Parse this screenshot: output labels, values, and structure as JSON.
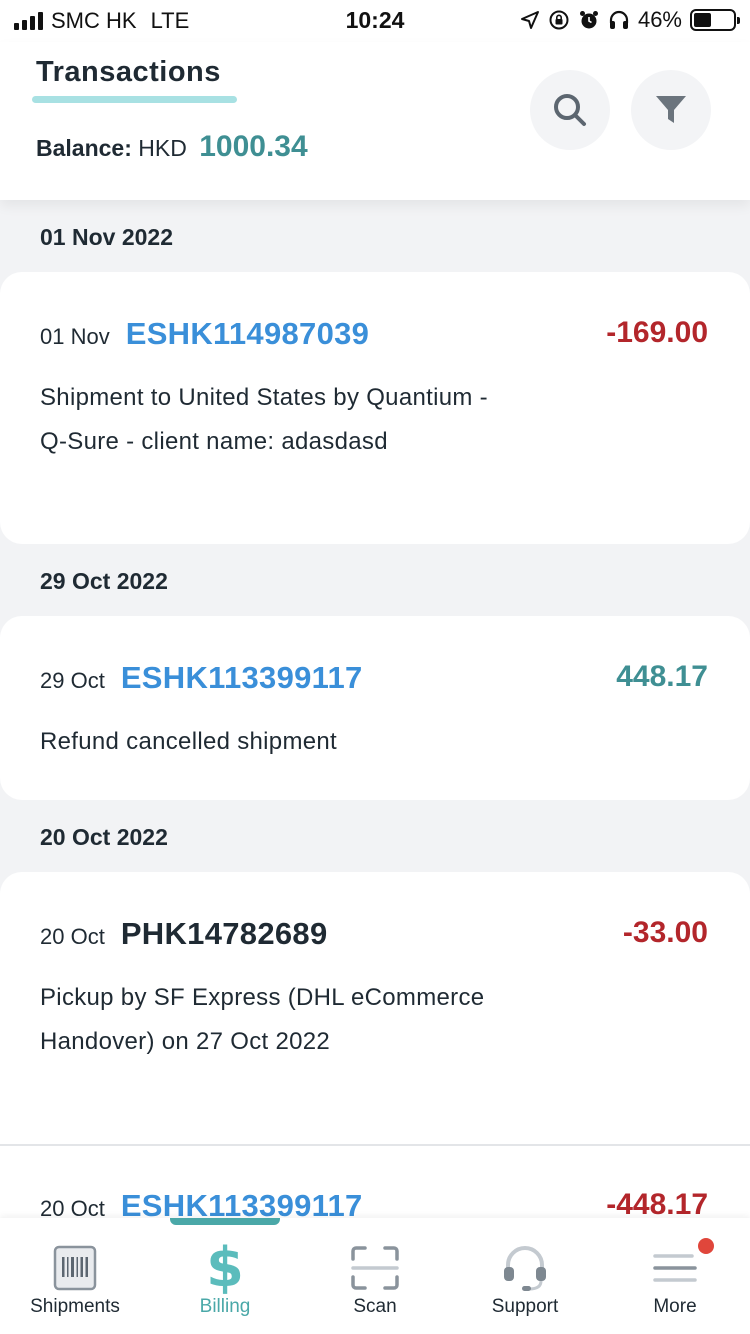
{
  "status_bar": {
    "carrier": "SMC HK",
    "network": "LTE",
    "time": "10:24",
    "battery": "46%",
    "battery_level": 0.46
  },
  "header": {
    "tab_title": "Transactions",
    "balance_label": "Balance:",
    "currency": "HKD",
    "balance_value": "1000.34"
  },
  "groups": [
    {
      "date_header": "01 Nov 2022",
      "items": [
        {
          "date": "01 Nov",
          "reference": "ESHK114987039",
          "amount": "-169.00",
          "description": "Shipment to United States by Quantium - Q-Sure - client name: adasdasd"
        }
      ]
    },
    {
      "date_header": "29 Oct 2022",
      "items": [
        {
          "date": "29 Oct",
          "reference": "ESHK113399117",
          "amount": "448.17",
          "description": "Refund cancelled shipment"
        }
      ]
    },
    {
      "date_header": "20 Oct 2022",
      "items": [
        {
          "date": "20 Oct",
          "reference": "PHK14782689",
          "amount": "-33.00",
          "description": "Pickup by SF Express (DHL eCommerce Handover) on 27 Oct 2022"
        },
        {
          "date": "20 Oct",
          "reference": "ESHK113399117",
          "amount": "-448.17",
          "description": ""
        }
      ]
    }
  ],
  "tabbar": {
    "active": "billing",
    "tabs": [
      {
        "id": "shipments",
        "label": "Shipments",
        "icon": "barcode-icon"
      },
      {
        "id": "billing",
        "label": "Billing",
        "icon": "dollar-icon"
      },
      {
        "id": "scan",
        "label": "Scan",
        "icon": "scan-frame-icon"
      },
      {
        "id": "support",
        "label": "Support",
        "icon": "headset-icon"
      },
      {
        "id": "more",
        "label": "More",
        "icon": "menu-lines-icon"
      }
    ]
  },
  "colors": {
    "accent_teal": "#3f8f93",
    "link_blue": "#3a8fd9",
    "negative_red": "#b3262b",
    "notification_dot": "#e0463b"
  }
}
